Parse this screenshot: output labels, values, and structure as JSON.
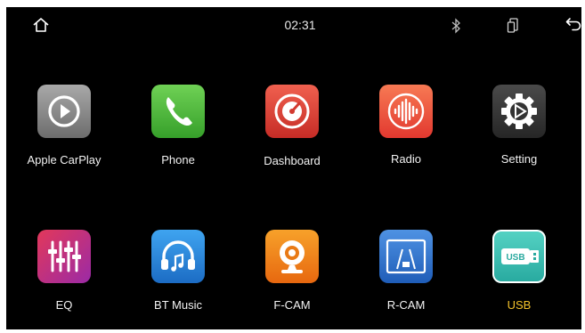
{
  "status_bar": {
    "time": "02:31",
    "icons": [
      "home-icon",
      "bluetooth-icon",
      "phone-mirror-icon",
      "back-arrow-icon"
    ]
  },
  "apps": [
    {
      "label": "Apple CarPlay",
      "icon": "carplay-icon"
    },
    {
      "label": "Phone",
      "icon": "phone-icon"
    },
    {
      "label": "Dashboard",
      "icon": "speedometer-icon"
    },
    {
      "label": "Radio",
      "icon": "radio-wave-icon"
    },
    {
      "label": "Setting",
      "icon": "gear-icon"
    },
    {
      "label": "EQ",
      "icon": "equalizer-icon"
    },
    {
      "label": "BT Music",
      "icon": "headphones-icon"
    },
    {
      "label": "F-CAM",
      "icon": "webcam-icon"
    },
    {
      "label": "R-CAM",
      "icon": "rear-camera-icon"
    },
    {
      "label": "USB",
      "icon": "usb-drive-icon",
      "badge_text": "USB"
    }
  ],
  "selected_app": "USB",
  "colors": {
    "background": "#000000",
    "label": "#f2f2f2",
    "selected_label": "#f4c22b",
    "carplay": "#8e8e8e",
    "phone": "#4cb93a",
    "dashboard": "#e2453b",
    "radio": "#ee5a3c",
    "setting": "#3a3a3a",
    "eq": "#d53270",
    "bt_music": "#2a87d8",
    "fcam": "#f08a18",
    "rcam": "#3377cf",
    "usb": "#3fc2b6"
  }
}
